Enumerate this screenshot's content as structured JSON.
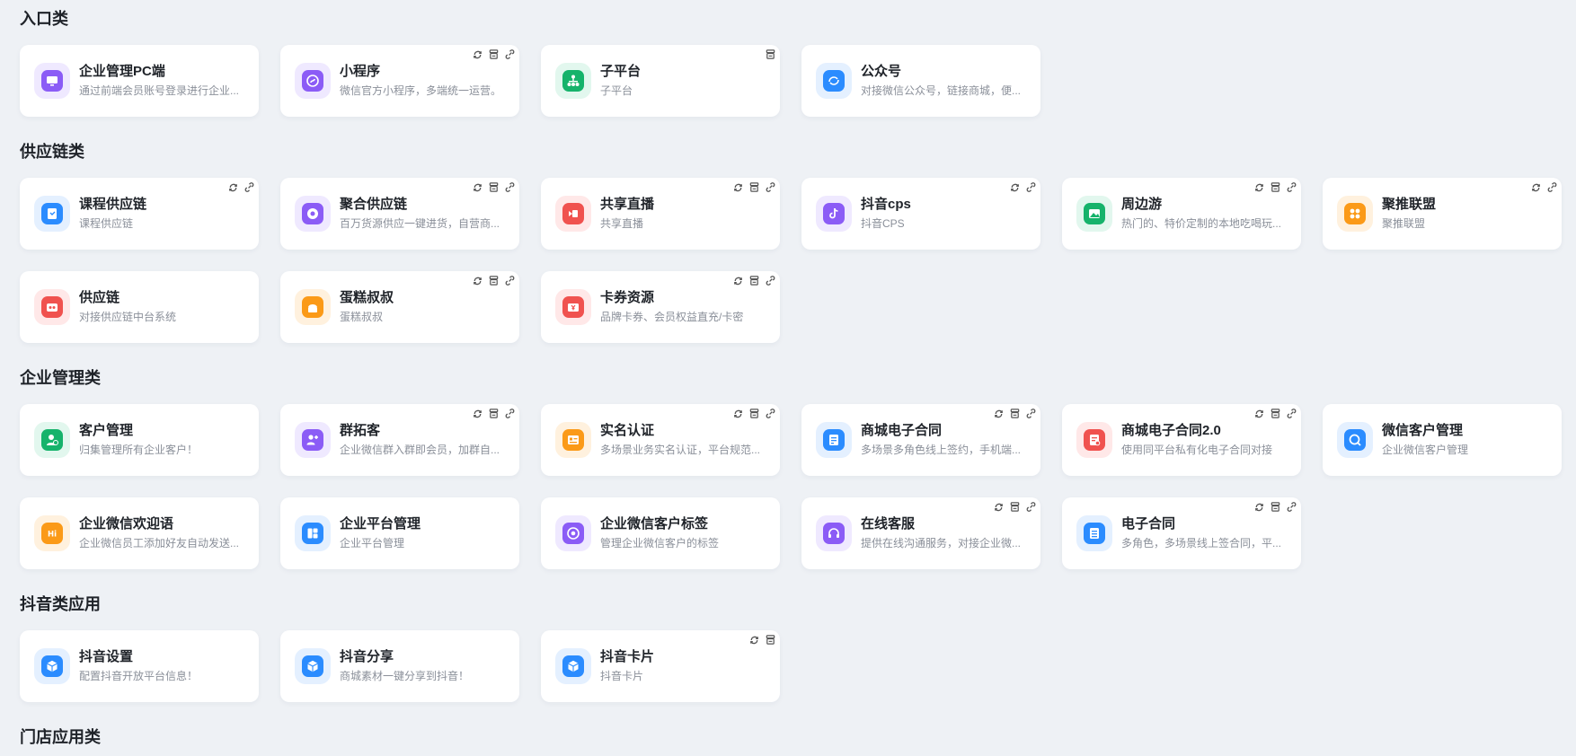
{
  "colors": {
    "purple_bg": "#efe9ff",
    "purple": "#8b5cf6",
    "green_bg": "#e2f7ee",
    "green": "#16b36b",
    "blue_bg": "#e4f0ff",
    "blue": "#2b8cff",
    "red_bg": "#ffe8e8",
    "red": "#f0524f",
    "orange_bg": "#fff1de",
    "orange": "#fb9a18"
  },
  "sections": [
    {
      "title": "入口类",
      "cards": [
        {
          "name": "企业管理PC端",
          "desc": "通过前端会员账号登录进行企业...",
          "icon": "monitor-icon",
          "tone": "purple",
          "badges": []
        },
        {
          "name": "小程序",
          "desc": "微信官方小程序，多端统一运营。",
          "icon": "mini-program-icon",
          "tone": "purple",
          "badges": [
            "sync-icon",
            "store-icon",
            "link-icon"
          ]
        },
        {
          "name": "子平台",
          "desc": "子平台",
          "icon": "org-chart-icon",
          "tone": "green",
          "badges": [
            "store-icon"
          ]
        },
        {
          "name": "公众号",
          "desc": "对接微信公众号，链接商城，便...",
          "icon": "official-account-icon",
          "tone": "blue",
          "badges": []
        }
      ]
    },
    {
      "title": "供应链类",
      "cards": [
        {
          "name": "课程供应链",
          "desc": "课程供应链",
          "icon": "course-icon",
          "tone": "blue",
          "badges": [
            "sync-icon",
            "link-icon"
          ]
        },
        {
          "name": "聚合供应链",
          "desc": "百万货源供应一键进货，自营商...",
          "icon": "aggregate-icon",
          "tone": "purple",
          "badges": [
            "sync-icon",
            "store-icon",
            "link-icon"
          ]
        },
        {
          "name": "共享直播",
          "desc": "共享直播",
          "icon": "live-icon",
          "tone": "red",
          "badges": [
            "sync-icon",
            "store-icon",
            "link-icon"
          ]
        },
        {
          "name": "抖音cps",
          "desc": "抖音CPS",
          "icon": "douyin-cps-icon",
          "tone": "purple",
          "badges": [
            "sync-icon",
            "link-icon"
          ]
        },
        {
          "name": "周边游",
          "desc": "热门的、特价定制的本地吃喝玩...",
          "icon": "landscape-icon",
          "tone": "green",
          "badges": [
            "sync-icon",
            "store-icon",
            "link-icon"
          ]
        },
        {
          "name": "聚推联盟",
          "desc": "聚推联盟",
          "icon": "alliance-icon",
          "tone": "orange",
          "badges": [
            "sync-icon",
            "link-icon"
          ]
        },
        {
          "name": "供应链",
          "desc": "对接供应链中台系统",
          "icon": "supply-chain-icon",
          "tone": "red",
          "badges": []
        },
        {
          "name": "蛋糕叔叔",
          "desc": "蛋糕叔叔",
          "icon": "cake-icon",
          "tone": "orange",
          "badges": [
            "sync-icon",
            "store-icon",
            "link-icon"
          ]
        },
        {
          "name": "卡券资源",
          "desc": "品牌卡券、会员权益直充/卡密",
          "icon": "coupon-icon",
          "tone": "red",
          "badges": [
            "sync-icon",
            "store-icon",
            "link-icon"
          ]
        }
      ]
    },
    {
      "title": "企业管理类",
      "cards": [
        {
          "name": "客户管理",
          "desc": "归集管理所有企业客户！",
          "icon": "customer-icon",
          "tone": "green",
          "badges": []
        },
        {
          "name": "群拓客",
          "desc": "企业微信群入群即会员，加群自...",
          "icon": "group-add-icon",
          "tone": "purple",
          "badges": [
            "sync-icon",
            "store-icon",
            "link-icon"
          ]
        },
        {
          "name": "实名认证",
          "desc": "多场景业务实名认证，平台规范...",
          "icon": "id-card-icon",
          "tone": "orange",
          "badges": [
            "sync-icon",
            "store-icon",
            "link-icon"
          ]
        },
        {
          "name": "商城电子合同",
          "desc": "多场景多角色线上签约，手机端...",
          "icon": "contract-icon",
          "tone": "blue",
          "badges": [
            "sync-icon",
            "store-icon",
            "link-icon"
          ]
        },
        {
          "name": "商城电子合同2.0",
          "desc": "使用同平台私有化电子合同对接",
          "icon": "contract-v2-icon",
          "tone": "red",
          "badges": [
            "sync-icon",
            "store-icon",
            "link-icon"
          ]
        },
        {
          "name": "微信客户管理",
          "desc": "企业微信客户管理",
          "icon": "chat-search-icon",
          "tone": "blue",
          "badges": []
        },
        {
          "name": "企业微信欢迎语",
          "desc": "企业微信员工添加好友自动发送...",
          "icon": "hi-icon",
          "tone": "orange",
          "badges": []
        },
        {
          "name": "企业平台管理",
          "desc": "企业平台管理",
          "icon": "dashboard-icon",
          "tone": "blue",
          "badges": []
        },
        {
          "name": "企业微信客户标签",
          "desc": "管理企业微信客户的标签",
          "icon": "tag-icon",
          "tone": "purple",
          "badges": []
        },
        {
          "name": "在线客服",
          "desc": "提供在线沟通服务，对接企业微...",
          "icon": "headset-icon",
          "tone": "purple",
          "badges": [
            "sync-icon",
            "store-icon",
            "link-icon"
          ]
        },
        {
          "name": "电子合同",
          "desc": "多角色，多场景线上签合同，平...",
          "icon": "document-icon",
          "tone": "blue",
          "badges": [
            "sync-icon",
            "store-icon",
            "link-icon"
          ]
        }
      ]
    },
    {
      "title": "抖音类应用",
      "cards": [
        {
          "name": "抖音设置",
          "desc": "配置抖音开放平台信息！",
          "icon": "cube-icon",
          "tone": "blue",
          "badges": []
        },
        {
          "name": "抖音分享",
          "desc": "商城素材一键分享到抖音！",
          "icon": "cube-icon",
          "tone": "blue",
          "badges": []
        },
        {
          "name": "抖音卡片",
          "desc": "抖音卡片",
          "icon": "cube-icon",
          "tone": "blue",
          "badges": [
            "sync-icon",
            "store-icon"
          ]
        }
      ]
    },
    {
      "title": "门店应用类",
      "cards": []
    }
  ]
}
